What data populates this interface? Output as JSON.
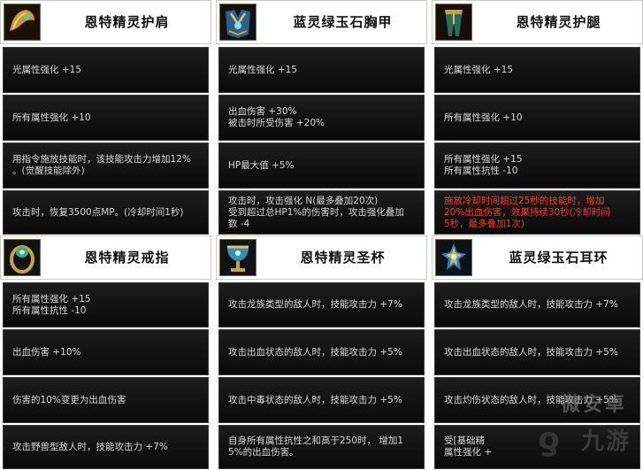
{
  "columns": [
    {
      "groups": [
        {
          "title": "恩特精灵护肩",
          "icon": "shoulder-armor-icon",
          "stats": [
            "光属性强化 +15",
            "所有属性强化 +10",
            "用指令施放技能时，该技能攻击力增加12%\n。(觉醒技能除外)",
            "攻击时，恢复3500点MP。(冷却时间1秒)"
          ]
        },
        {
          "title": "恩特精灵戒指",
          "icon": "ring-icon",
          "stats": [
            "所有属性强化 +15\n所有属性抗性 -10",
            "出血伤害 +10%",
            "伤害的10%变更为出血伤害",
            "攻击野兽型敌人时，技能攻击力 +7%"
          ]
        }
      ]
    },
    {
      "groups": [
        {
          "title": "蓝灵绿玉石胸甲",
          "icon": "chest-armor-icon",
          "stats": [
            "光属性强化 +15",
            "出血伤害 +30%\n被击时所受伤害 +20%",
            "HP最大值 +5%",
            "攻击时，攻击强化 N(最多叠加20次)\n受到超过总HP1%的伤害时，攻击强化叠加\n数 -4"
          ]
        },
        {
          "title": "恩特精灵圣杯",
          "icon": "chalice-icon",
          "stats": [
            "攻击龙族类型的敌人时，技能攻击力 +7%",
            "攻击出血状态的敌人时，技能攻击力 +5%",
            "攻击中毒状态的敌人时，技能攻击力 +5%",
            "自身所有属性抗性之和高于250时， 增加1\n5%的出血伤害。"
          ]
        }
      ]
    },
    {
      "groups": [
        {
          "title": "恩特精灵护腿",
          "icon": "leg-armor-icon",
          "stats": [
            "光属性强化 +15",
            "所有属性强化 +10",
            "所有属性强化 +15\n所有属性抗性 -10",
            "施放冷却时间超过25秒的技能时，增加\n20%出血伤害，效果持续30秒(冷却时间\n5秒，最多叠加1次)"
          ]
        },
        {
          "title": "蓝灵绿玉石耳环",
          "icon": "earring-icon",
          "stats": [
            "攻击龙族类型的敌人时，技能攻击力 +7%",
            "攻击出血状态的敌人时，技能攻击力 +5%",
            "攻击灼伤状态的敌人时，技能攻击力 +5%",
            "受[基础精\n属性强化 +"
          ]
        }
      ]
    }
  ],
  "highlight": {
    "col": 2,
    "group": 0,
    "stat": 3,
    "color": "#ff3a2a"
  },
  "watermark": {
    "text": "九游",
    "faint_text": "微安卓"
  }
}
